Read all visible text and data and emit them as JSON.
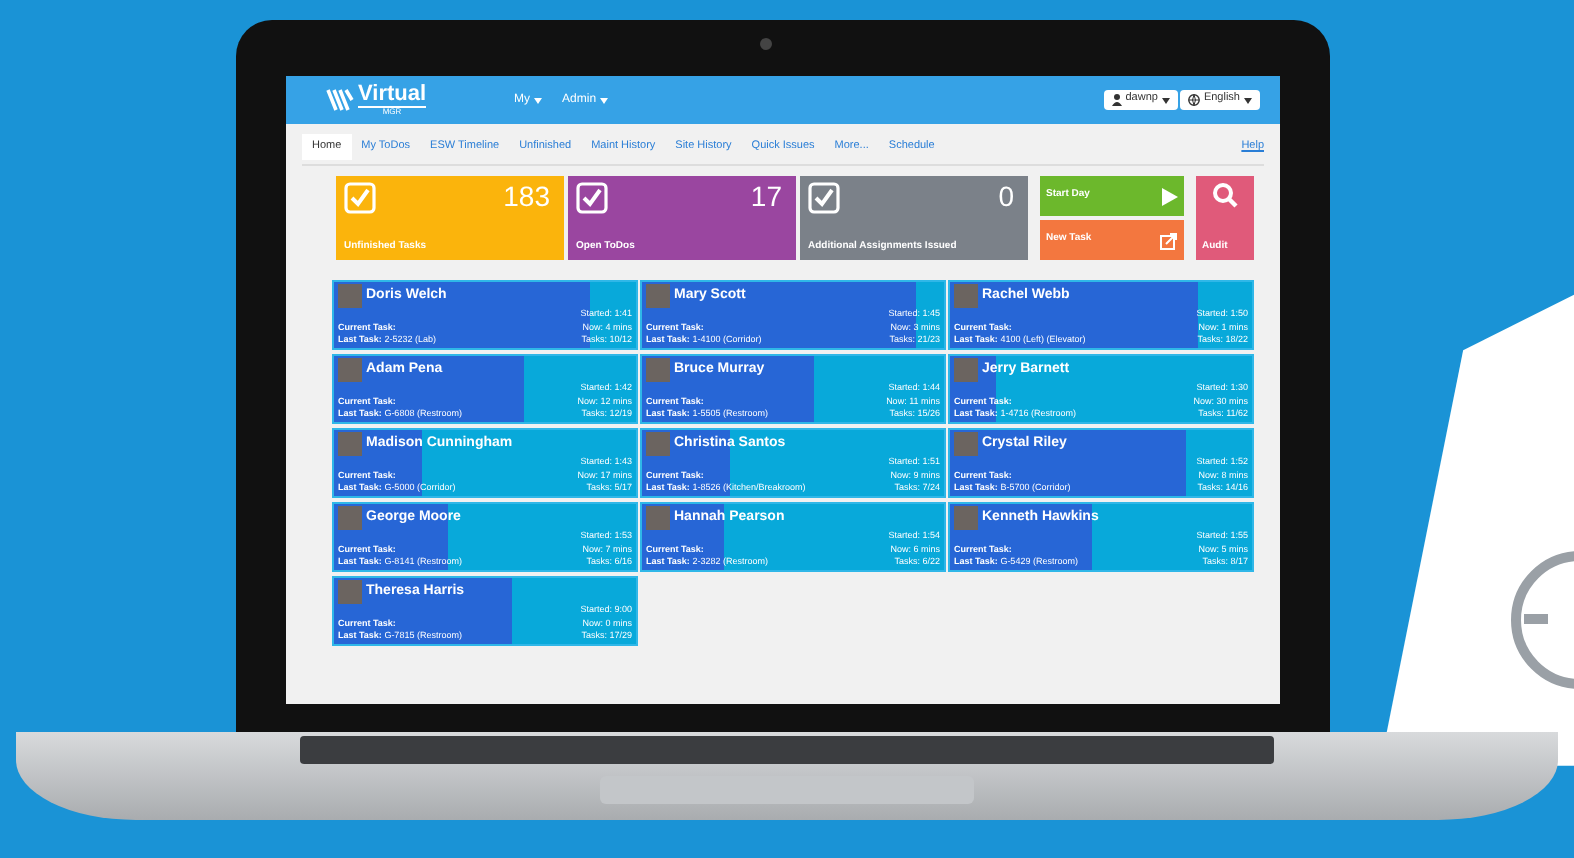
{
  "navbar": {
    "logo_text": "Virtual",
    "logo_sub": "MGR",
    "menus": [
      {
        "label": "My"
      },
      {
        "label": "Admin"
      }
    ],
    "user_button": "dawnp",
    "language_button": "English"
  },
  "tabs": [
    {
      "label": "Home",
      "selected": true
    },
    {
      "label": "My ToDos",
      "selected": false
    },
    {
      "label": "ESW Timeline",
      "selected": false
    },
    {
      "label": "Unfinished",
      "selected": false
    },
    {
      "label": "Maint History",
      "selected": false
    },
    {
      "label": "Site History",
      "selected": false
    },
    {
      "label": "Quick Issues",
      "selected": false
    },
    {
      "label": "More...",
      "selected": false
    },
    {
      "label": "Schedule",
      "selected": false
    }
  ],
  "help_link": "Help",
  "summary_tiles": [
    {
      "count": "183",
      "label": "Unfinished Tasks",
      "color": "#fbb40c"
    },
    {
      "count": "17",
      "label": "Open ToDos",
      "color": "#9a46a0"
    },
    {
      "count": "0",
      "label": "Additional Assignments Issued",
      "color": "#7b8189"
    }
  ],
  "action_buttons": [
    {
      "label": "Start Day",
      "kind": "play",
      "color": "#6cb82c"
    },
    {
      "label": "New Task",
      "kind": "share",
      "color": "#f3773f"
    }
  ],
  "audit_button": "Audit",
  "workers": [
    {
      "name": "Doris Welch",
      "started": "Started: 1:41",
      "now": "Now: 4 mins",
      "current_label": "Current Task:",
      "last_label": "Last Task:",
      "last_task": "2-5232 (Lab)",
      "tasks": "Tasks: 10/12",
      "level": 0.85
    },
    {
      "name": "Mary Scott",
      "started": "Started: 1:45",
      "now": "Now: 3 mins",
      "current_label": "Current Task:",
      "last_label": "Last Task:",
      "last_task": "1-4100 (Corridor)",
      "tasks": "Tasks: 21/23",
      "level": 0.91
    },
    {
      "name": "Rachel Webb",
      "started": "Started: 1:50",
      "now": "Now: 1 mins",
      "current_label": "Current Task:",
      "last_label": "Last Task:",
      "last_task": "4100 (Left) (Elevator)",
      "tasks": "Tasks: 18/22",
      "level": 0.82
    },
    {
      "name": "Adam Pena",
      "started": "Started: 1:42",
      "now": "Now: 12 mins",
      "current_label": "Current Task:",
      "last_label": "Last Task:",
      "last_task": "G-6808 (Restroom)",
      "tasks": "Tasks: 12/19",
      "level": 0.63
    },
    {
      "name": "Bruce Murray",
      "started": "Started: 1:44",
      "now": "Now: 11 mins",
      "current_label": "Current Task:",
      "last_label": "Last Task:",
      "last_task": "1-5505 (Restroom)",
      "tasks": "Tasks: 15/26",
      "level": 0.57
    },
    {
      "name": "Jerry Barnett",
      "started": "Started: 1:30",
      "now": "Now: 30 mins",
      "current_label": "Current Task:",
      "last_label": "Last Task:",
      "last_task": "1-4716 (Restroom)",
      "tasks": "Tasks: 11/62",
      "level": 0.15
    },
    {
      "name": "Madison Cunningham",
      "started": "Started: 1:43",
      "now": "Now: 17 mins",
      "current_label": "Current Task:",
      "last_label": "Last Task:",
      "last_task": "G-5000 (Corridor)",
      "tasks": "Tasks: 5/17",
      "level": 0.29
    },
    {
      "name": "Christina Santos",
      "started": "Started: 1:51",
      "now": "Now: 9 mins",
      "current_label": "Current Task:",
      "last_label": "Last Task:",
      "last_task": "1-8526 (Kitchen/Breakroom)",
      "tasks": "Tasks: 7/24",
      "level": 0.29
    },
    {
      "name": "Crystal Riley",
      "started": "Started: 1:52",
      "now": "Now: 8 mins",
      "current_label": "Current Task:",
      "last_label": "Last Task:",
      "last_task": "B-5700 (Corridor)",
      "tasks": "Tasks: 14/16",
      "level": 0.78
    },
    {
      "name": "George Moore",
      "started": "Started: 1:53",
      "now": "Now: 7 mins",
      "current_label": "Current Task:",
      "last_label": "Last Task:",
      "last_task": "G-8141 (Restroom)",
      "tasks": "Tasks: 6/16",
      "level": 0.38
    },
    {
      "name": "Hannah Pearson",
      "started": "Started: 1:54",
      "now": "Now: 6 mins",
      "current_label": "Current Task:",
      "last_label": "Last Task:",
      "last_task": "2-3282 (Restroom)",
      "tasks": "Tasks: 6/22",
      "level": 0.27
    },
    {
      "name": "Kenneth Hawkins",
      "started": "Started: 1:55",
      "now": "Now: 5 mins",
      "current_label": "Current Task:",
      "last_label": "Last Task:",
      "last_task": "G-5429 (Restroom)",
      "tasks": "Tasks: 8/17",
      "level": 0.47
    },
    {
      "name": "Theresa Harris",
      "started": "Started: 9:00",
      "now": "Now: 0 mins",
      "current_label": "Current Task:",
      "last_label": "Last Task:",
      "last_task": "G-7815 (Restroom)",
      "tasks": "Tasks: 17/29",
      "level": 0.59
    }
  ]
}
